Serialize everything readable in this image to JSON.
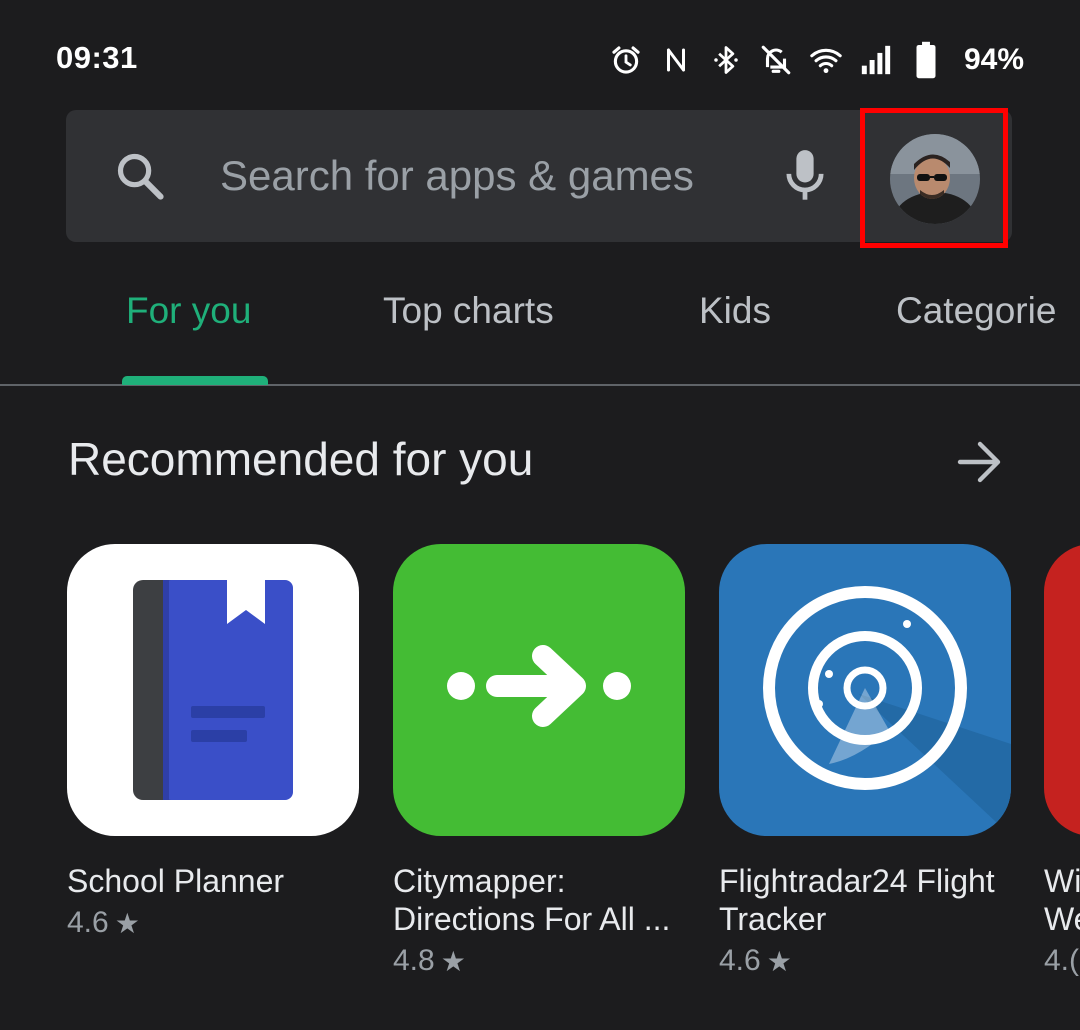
{
  "status_bar": {
    "time": "09:31",
    "battery_percent": "94%",
    "icons": [
      "alarm-icon",
      "nfc-icon",
      "bluetooth-icon",
      "notifications-off-icon",
      "wifi-icon",
      "signal-icon",
      "battery-icon"
    ]
  },
  "search": {
    "placeholder": "Search for apps & games",
    "icon": "search-icon",
    "voice_icon": "mic-icon",
    "avatar_highlight_color": "#ff0000"
  },
  "tabs": [
    {
      "label": "For you",
      "active": true
    },
    {
      "label": "Top charts",
      "active": false
    },
    {
      "label": "Kids",
      "active": false
    },
    {
      "label": "Categorie",
      "active": false
    }
  ],
  "accent_color": "#1fb07a",
  "section": {
    "title": "Recommended for you",
    "more_icon": "arrow-right-icon"
  },
  "apps": [
    {
      "name": "School Planner",
      "rating": "4.6",
      "star": "★"
    },
    {
      "name": "Citymapper: Directions For All ...",
      "rating": "4.8",
      "star": "★"
    },
    {
      "name": "Flightradar24 Flight Tracker",
      "rating": "4.6",
      "star": "★"
    },
    {
      "name_line1": "Wi",
      "name_line2": "We",
      "rating": "4.("
    }
  ]
}
